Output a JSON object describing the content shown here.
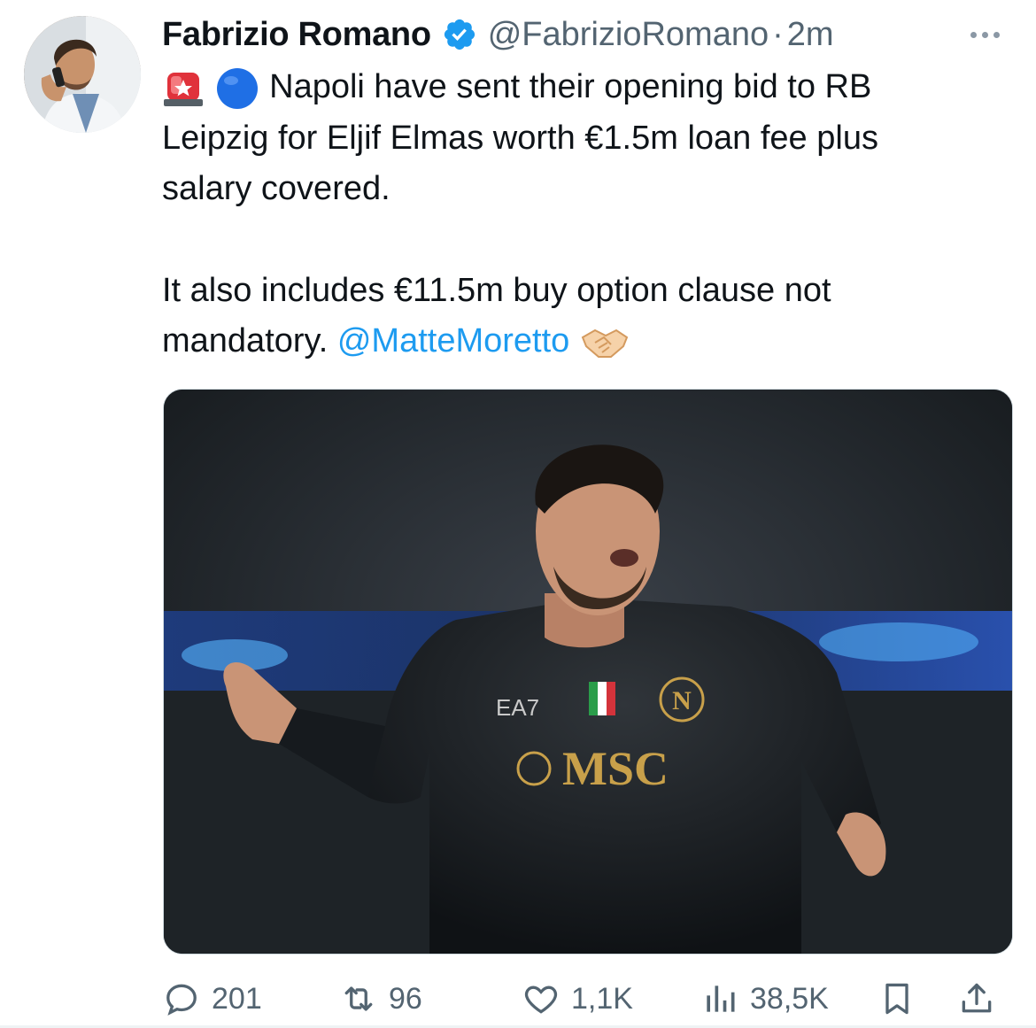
{
  "tweet": {
    "author_name": "Fabrizio Romano",
    "handle": "@FabrizioRomano",
    "separator": "·",
    "time": "2m",
    "line1": "Napoli have sent their opening bid to RB",
    "line2": "Leipzig for Eljif Elmas worth €1.5m loan fee plus",
    "line3": "salary covered.",
    "line4": "It also includes €11.5m buy option clause not",
    "line5": "mandatory.",
    "mention": "@MatteMoretto",
    "media_texts": {
      "sponsor": "MSC",
      "brand": "EA7",
      "crest": "N"
    }
  },
  "actions": {
    "replies": "201",
    "retweets": "96",
    "likes": "1,1K",
    "views": "38,5K"
  },
  "icons": {
    "verified": "verified-badge-icon",
    "siren": "siren-emoji-icon",
    "blue_circle": "blue-circle-emoji-icon",
    "handshake": "handshake-emoji-icon",
    "reply": "reply-icon",
    "retweet": "retweet-icon",
    "like": "heart-icon",
    "views": "views-chart-icon",
    "bookmark": "bookmark-icon",
    "share": "share-icon",
    "more": "more-icon"
  },
  "colors": {
    "accent": "#1d9bf0",
    "text": "#0f1419",
    "muted": "#536471"
  }
}
